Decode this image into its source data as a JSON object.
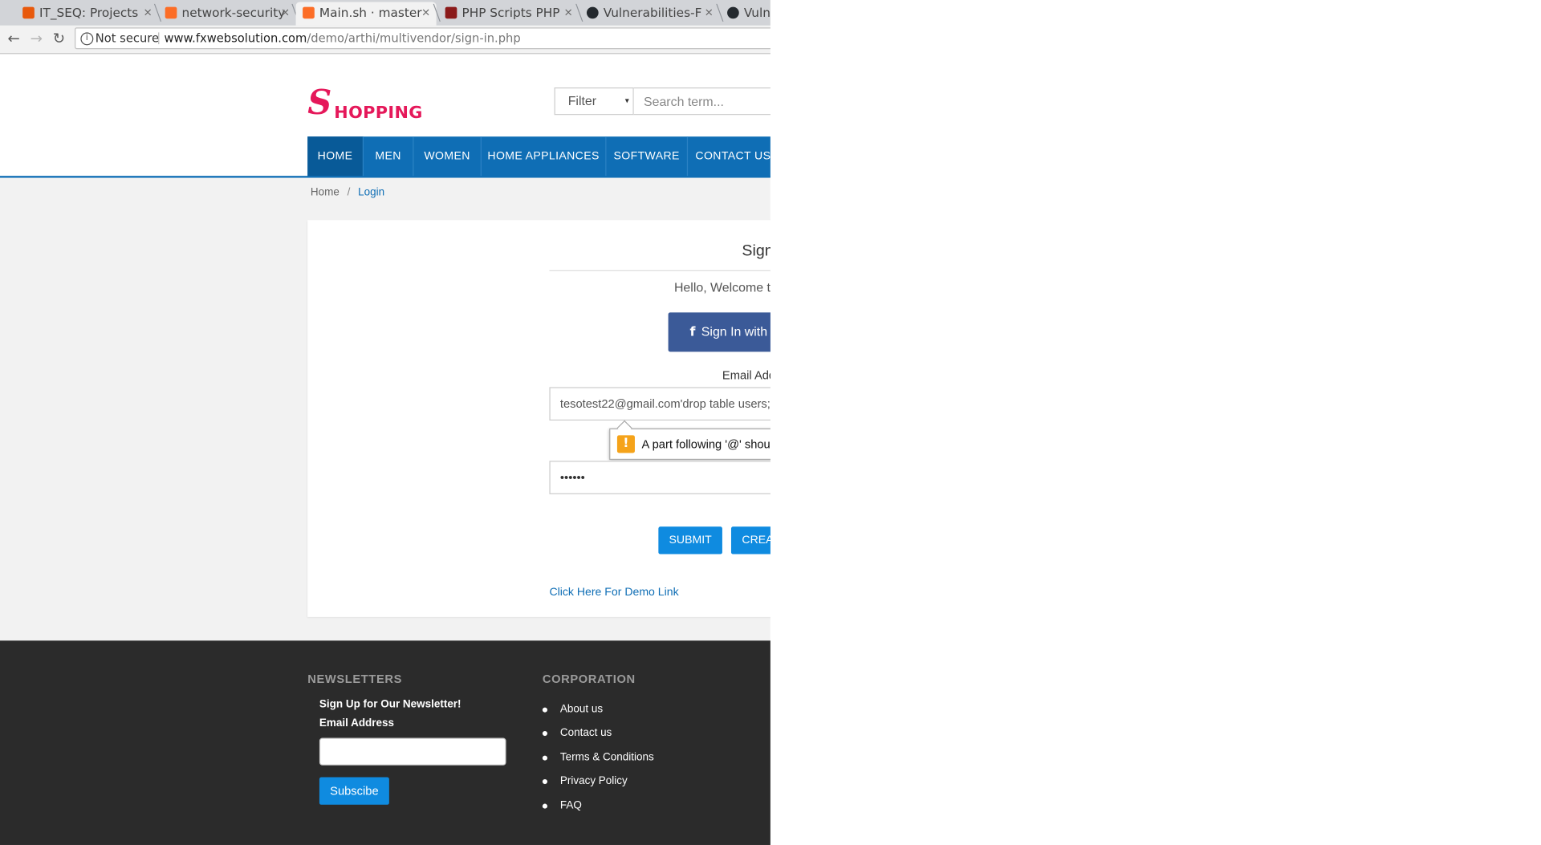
{
  "browser": {
    "tabs": [
      {
        "title": "IT_SEQ: Projects",
        "favicon_color": "#e8590c"
      },
      {
        "title": "network-security",
        "favicon_color": "#fc6d26"
      },
      {
        "title": "Main.sh · master",
        "favicon_color": "#fc6d26"
      },
      {
        "title": "PHP Scripts PHP",
        "favicon_color": "#8b1a1a"
      },
      {
        "title": "Vulnerabilities-F",
        "favicon_color": "#24292e"
      },
      {
        "title": "Vuln",
        "favicon_color": "#24292e"
      }
    ],
    "close_glyph": "×",
    "back_glyph": "←",
    "forward_glyph": "→",
    "reload_glyph": "↻",
    "security_icon_glyph": "i",
    "security_label": "Not secure",
    "url_host": "www.fxwebsolution.com",
    "url_path": "/demo/arthi/multivendor/sign-in.php"
  },
  "site": {
    "logo_initial": "S",
    "logo_rest": "HOPPING",
    "logo_color": "#e5185a",
    "filter": {
      "selected": "Filter",
      "caret": "▾"
    },
    "search_placeholder": "Search term...",
    "nav": [
      "HOME",
      "MEN",
      "WOMEN",
      "HOME APPLIANCES",
      "SOFTWARE",
      "CONTACT US"
    ],
    "nav_color": "#0f6eb5",
    "breadcrumb": {
      "home": "Home",
      "separator": "/",
      "current": "Login"
    }
  },
  "login": {
    "title": "Sign",
    "welcome": "Hello, Welcome t",
    "facebook_icon_glyph": "f",
    "facebook_button": "Sign In with",
    "email_label": "Email Add",
    "email_value": "tesotest22@gmail.com'drop table users;",
    "validation_icon_glyph": "!",
    "validation_message": "A part following '@' shou",
    "password_value": "••••••",
    "submit_label": "SUBMIT",
    "create_label": "CREA",
    "demo_link": "Click Here For Demo Link"
  },
  "footer": {
    "newsletter_heading": "NEWSLETTERS",
    "newsletter_signup": "Sign Up for Our Newsletter!",
    "email_label": "Email Address",
    "subscribe_label": "Subscibe",
    "corporation_heading": "CORPORATION",
    "links": [
      "About us",
      "Contact us",
      "Terms & Conditions",
      "Privacy Policy",
      "FAQ"
    ]
  }
}
